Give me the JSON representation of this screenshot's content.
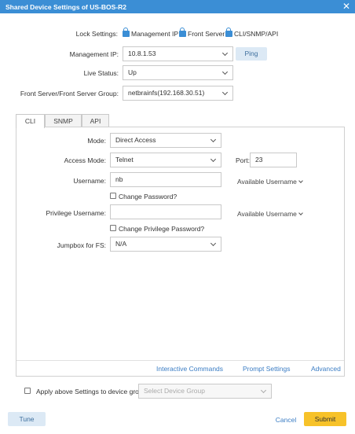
{
  "window": {
    "title": "Shared Device Settings of US-BOS-R2",
    "close_icon": "close-icon"
  },
  "lock_settings": {
    "label": "Lock Settings:",
    "items": [
      {
        "label": "Management IP"
      },
      {
        "label": "Front Server"
      },
      {
        "label": "CLI/SNMP/API"
      }
    ]
  },
  "management_ip": {
    "label": "Management IP:",
    "value": "10.8.1.53",
    "ping_label": "Ping"
  },
  "live_status": {
    "label": "Live Status:",
    "value": "Up"
  },
  "front_server": {
    "label": "Front Server/Front Server Group:",
    "value": "netbrainfs(192.168.30.51)"
  },
  "tabs": [
    {
      "label": "CLI",
      "active": true
    },
    {
      "label": "SNMP",
      "active": false
    },
    {
      "label": "API",
      "active": false
    }
  ],
  "cli": {
    "mode": {
      "label": "Mode:",
      "value": "Direct Access"
    },
    "access_mode": {
      "label": "Access Mode:",
      "value": "Telnet"
    },
    "port": {
      "label": "Port:",
      "value": "23"
    },
    "username": {
      "label": "Username:",
      "value": "nb"
    },
    "available_username": "Available Username",
    "change_password": "Change Password?",
    "privilege_username": {
      "label": "Privilege Username:",
      "value": ""
    },
    "available_username_2": "Available Username",
    "change_privilege_password": "Change Privilege Password?",
    "jumpbox": {
      "label": "Jumpbox for FS:",
      "value": "N/A"
    }
  },
  "panel_links": {
    "interactive_commands": "Interactive Commands",
    "prompt_settings": "Prompt Settings",
    "advanced": "Advanced"
  },
  "apply_group": {
    "label": "Apply above Settings to device group:",
    "placeholder": "Select Device Group"
  },
  "footer": {
    "tune": "Tune",
    "cancel": "Cancel",
    "submit": "Submit"
  },
  "colors": {
    "accent": "#3b8ed5",
    "submit": "#f7c229",
    "link": "#3b7dc4"
  }
}
